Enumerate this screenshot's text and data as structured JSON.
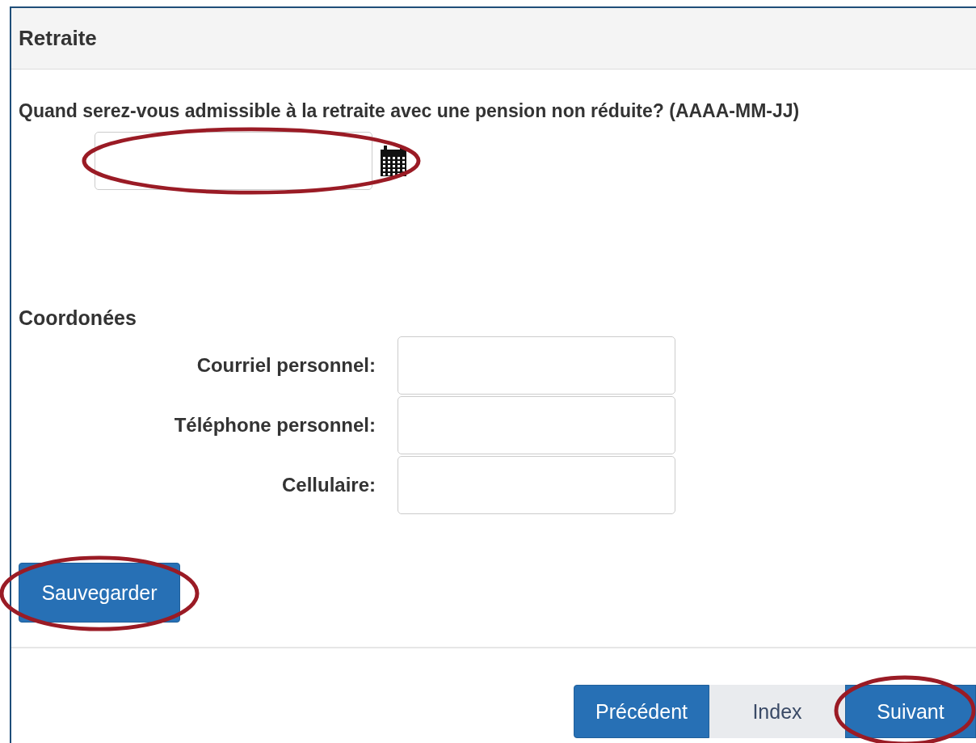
{
  "panel": {
    "title": "Retraite"
  },
  "question": {
    "label": "Quand serez-vous admissible à la retraite avec une pension non réduite? (AAAA-MM-JJ)",
    "highlighted": true
  },
  "contact": {
    "heading": "Coordonées",
    "fields": [
      {
        "label": "Courriel personnel:"
      },
      {
        "label": "Téléphone personnel:"
      },
      {
        "label": "Cellulaire:"
      }
    ]
  },
  "save_button": {
    "label": "Sauvegarder",
    "highlighted": true
  },
  "pager": [
    {
      "label": "Précédent",
      "kind": "primary",
      "highlighted": false
    },
    {
      "label": "Index",
      "kind": "default",
      "highlighted": false
    },
    {
      "label": "Suivant",
      "kind": "primary",
      "highlighted": true
    }
  ]
}
